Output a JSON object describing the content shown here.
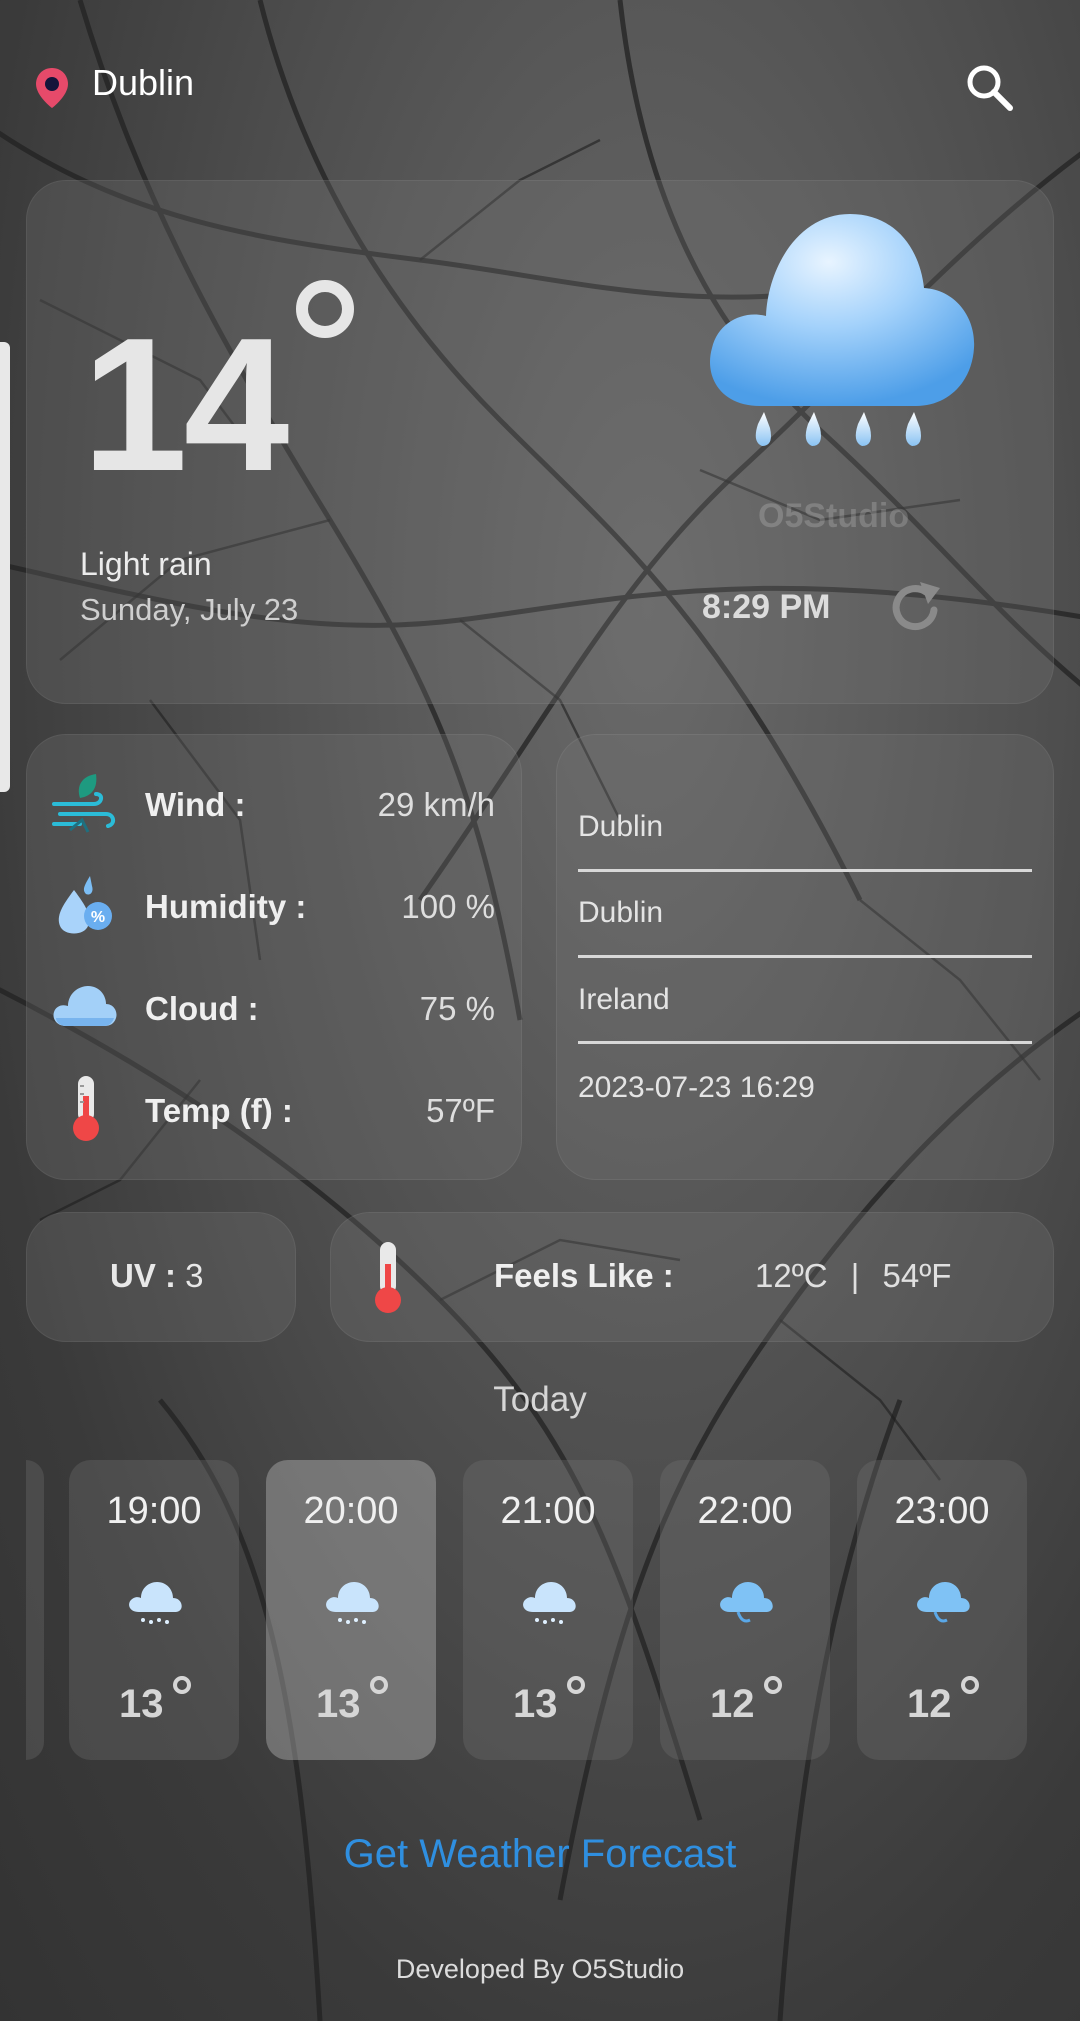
{
  "header": {
    "city": "Dublin"
  },
  "current": {
    "temperature": "14",
    "condition": "Light rain",
    "date": "Sunday, July 23",
    "time": "8:29 PM",
    "watermark": "O5Studio"
  },
  "details": {
    "wind": {
      "label": "Wind  :",
      "value": "29 km/h"
    },
    "humidity": {
      "label": "Humidity :",
      "value": "100 %"
    },
    "cloud": {
      "label": "Cloud :",
      "value": "75 %"
    },
    "temp_f": {
      "label": "Temp (f) :",
      "value": "57ºF"
    }
  },
  "location": {
    "line1": "Dublin",
    "line2": "Dublin",
    "line3": "Ireland",
    "localtime": "2023-07-23 16:29"
  },
  "uv": {
    "label": "UV :",
    "value": "3"
  },
  "feels_like": {
    "label": "Feels Like :",
    "celsius": "12ºC",
    "separator": "|",
    "fahrenheit": "54ºF"
  },
  "today_label": "Today",
  "hourly": [
    {
      "time": "19:00",
      "temp": "13",
      "icon": "rain-cloud-icon"
    },
    {
      "time": "20:00",
      "temp": "13",
      "icon": "rain-cloud-icon"
    },
    {
      "time": "21:00",
      "temp": "13",
      "icon": "rain-cloud-icon"
    },
    {
      "time": "22:00",
      "temp": "12",
      "icon": "drizzle-cloud-icon"
    },
    {
      "time": "23:00",
      "temp": "12",
      "icon": "drizzle-cloud-icon"
    }
  ],
  "forecast_button": "Get Weather Forecast",
  "footer": "Developed By O5Studio",
  "colors": {
    "accent": "#2f8fe0",
    "pin": "#e64a6a",
    "thermo": "#ef4747"
  }
}
